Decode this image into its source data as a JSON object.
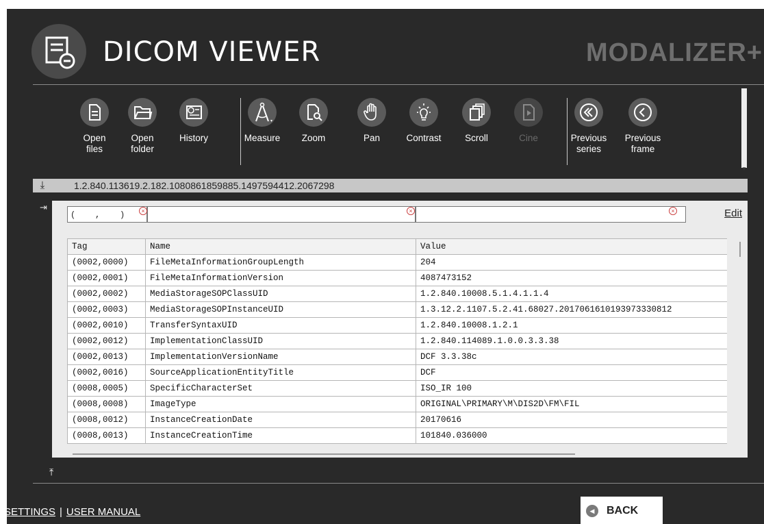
{
  "header": {
    "title": "DICOM VIEWER",
    "brand": "MODALIZER+",
    "logo_icon": "document-icon"
  },
  "toolbar": {
    "tools": [
      {
        "label": "Open\nfiles",
        "icon": "file-icon",
        "enabled": true
      },
      {
        "label": "Open\nfolder",
        "icon": "folder-icon",
        "enabled": true
      },
      {
        "label": "History",
        "icon": "history-icon",
        "enabled": true
      },
      {
        "label": "Measure",
        "icon": "compass-icon",
        "enabled": true
      },
      {
        "label": "Zoom",
        "icon": "magnifier-icon",
        "enabled": true
      },
      {
        "label": "Pan",
        "icon": "hand-icon",
        "enabled": true
      },
      {
        "label": "Contrast",
        "icon": "bulb-icon",
        "enabled": true
      },
      {
        "label": "Scroll",
        "icon": "layers-icon",
        "enabled": true
      },
      {
        "label": "Cine",
        "icon": "play-icon",
        "enabled": false
      },
      {
        "label": "Previous\nseries",
        "icon": "double-chevron-left-icon",
        "enabled": true
      },
      {
        "label": "Previous\nframe",
        "icon": "chevron-left-icon",
        "enabled": true
      }
    ]
  },
  "path": "1.2.840.113619.2.182.1080861859885.1497594412.2067298",
  "filters": {
    "tag_value": "(    ,    )",
    "name_value": "",
    "value_value": "",
    "edit_label": "Edit"
  },
  "table": {
    "headers": [
      "Tag",
      "Name",
      "Value"
    ],
    "rows": [
      [
        "(0002,0000)",
        "FileMetaInformationGroupLength",
        "204"
      ],
      [
        "(0002,0001)",
        "FileMetaInformationVersion",
        "4087473152"
      ],
      [
        "(0002,0002)",
        "MediaStorageSOPClassUID",
        "1.2.840.10008.5.1.4.1.1.4"
      ],
      [
        "(0002,0003)",
        "MediaStorageSOPInstanceUID",
        "1.3.12.2.1107.5.2.41.68027.2017061610193973330812"
      ],
      [
        "(0002,0010)",
        "TransferSyntaxUID",
        "1.2.840.10008.1.2.1"
      ],
      [
        "(0002,0012)",
        "ImplementationClassUID",
        "1.2.840.114089.1.0.0.3.3.38"
      ],
      [
        "(0002,0013)",
        "ImplementationVersionName",
        "DCF 3.3.38c"
      ],
      [
        "(0002,0016)",
        "SourceApplicationEntityTitle",
        "DCF"
      ],
      [
        "(0008,0005)",
        "SpecificCharacterSet",
        "ISO_IR 100"
      ],
      [
        "(0008,0008)",
        "ImageType",
        "ORIGINAL\\PRIMARY\\M\\DIS2D\\FM\\FIL"
      ],
      [
        "(0008,0012)",
        "InstanceCreationDate",
        "20170616"
      ],
      [
        "(0008,0013)",
        "InstanceCreationTime",
        "101840.036000"
      ]
    ]
  },
  "footer": {
    "settings_label": "SETTINGS",
    "separator": "|",
    "manual_label": "USER MANUAL",
    "back_label": "BACK"
  }
}
